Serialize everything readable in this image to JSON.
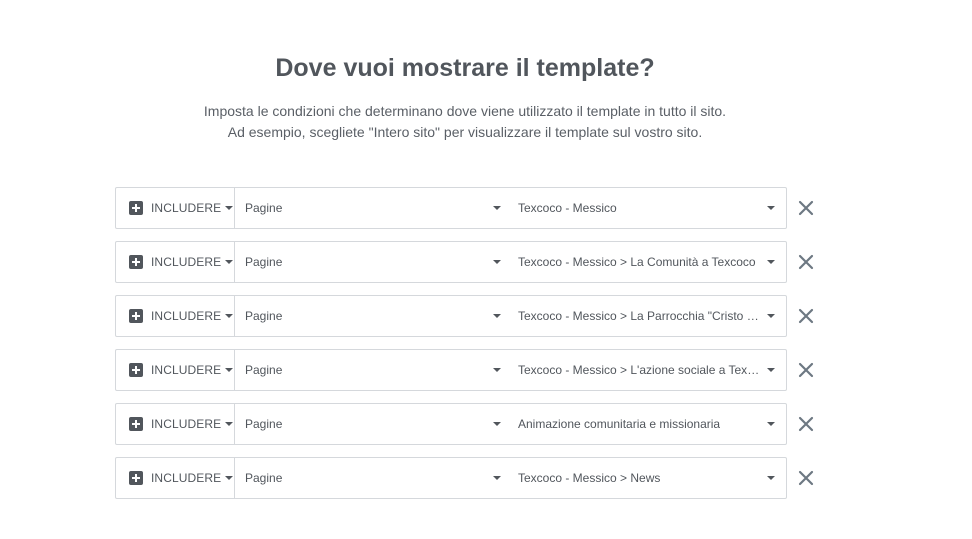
{
  "header": {
    "title": "Dove vuoi mostrare il template?",
    "description_line1": "Imposta le condizioni che determinano dove viene utilizzato il template in tutto il sito.",
    "description_line2": "Ad esempio, scegliete \"Intero sito\" per visualizzare il template sul vostro sito."
  },
  "conditions": [
    {
      "type": "INCLUDERE",
      "name": "Pagine",
      "sub": "Texcoco - Messico"
    },
    {
      "type": "INCLUDERE",
      "name": "Pagine",
      "sub": "Texcoco - Messico > La Comunità a Texcoco"
    },
    {
      "type": "INCLUDERE",
      "name": "Pagine",
      "sub": "Texcoco - Messico > La Parrocchia \"Cristo R..."
    },
    {
      "type": "INCLUDERE",
      "name": "Pagine",
      "sub": "Texcoco - Messico > L'azione sociale a Texc..."
    },
    {
      "type": "INCLUDERE",
      "name": "Pagine",
      "sub": "Animazione comunitaria e missionaria"
    },
    {
      "type": "INCLUDERE",
      "name": "Pagine",
      "sub": "Texcoco - Messico > News"
    }
  ],
  "icons": {
    "plus": "plus-square-icon",
    "caret": "caret-down-icon",
    "remove": "close-icon"
  },
  "colors": {
    "text": "#51565c",
    "border": "#d5d8dc",
    "remove": "#6d7882"
  }
}
